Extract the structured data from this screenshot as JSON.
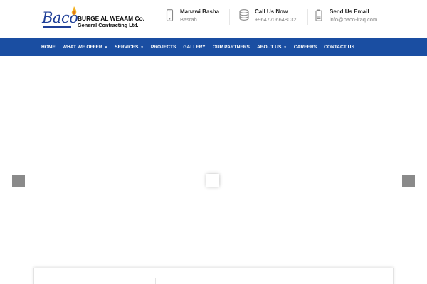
{
  "header": {
    "logo": {
      "brand": "Baco",
      "company_line1": "BURGE AL WEAAM Co.",
      "company_line2": "General Contracting Ltd."
    },
    "contacts": [
      {
        "title": "Manawi Basha",
        "sub": "Basrah",
        "icon": "mobile-phone-icon"
      },
      {
        "title": "Call Us Now",
        "sub": "+9647706648032",
        "icon": "database-stack-icon"
      },
      {
        "title": "Send Us Email",
        "sub": "info@baco-iraq.com",
        "icon": "battery-icon"
      }
    ]
  },
  "nav": {
    "items": [
      {
        "label": "HOME",
        "dropdown": false
      },
      {
        "label": "WHAT WE OFFER",
        "dropdown": true
      },
      {
        "label": "SERVICES",
        "dropdown": true
      },
      {
        "label": "PROJECTS",
        "dropdown": false
      },
      {
        "label": "GALLERY",
        "dropdown": false
      },
      {
        "label": "OUR PARTNERS",
        "dropdown": false
      },
      {
        "label": "ABOUT US",
        "dropdown": true
      },
      {
        "label": "CAREERS",
        "dropdown": false
      },
      {
        "label": "CONTACT US",
        "dropdown": false
      }
    ],
    "caret": "▼"
  },
  "colors": {
    "nav_background": "#1a4ea2",
    "brand_blue": "#1f3f98",
    "flame": "#f2b01e",
    "arrow_gray": "#8a8a8a"
  }
}
